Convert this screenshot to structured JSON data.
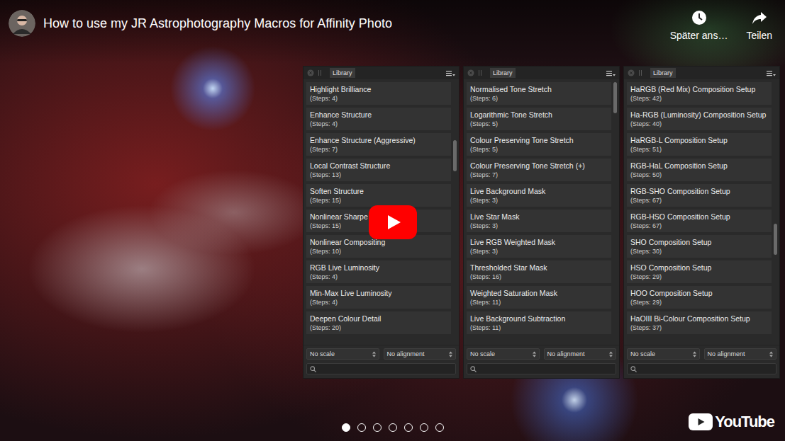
{
  "video": {
    "title": "How to use my JR Astrophotography Macros for Affinity Photo"
  },
  "actions": [
    {
      "label": "Später ans…",
      "kind": "clock"
    },
    {
      "label": "Teilen",
      "kind": "share"
    }
  ],
  "panels": [
    {
      "tab": "Library",
      "scroll": 0.28,
      "scale": "No scale",
      "alignment": "No alignment",
      "items": [
        {
          "name": "Highlight Brilliance",
          "steps": "(Steps: 4)"
        },
        {
          "name": "Enhance Structure",
          "steps": "(Steps: 4)"
        },
        {
          "name": "Enhance Structure (Aggressive)",
          "steps": "(Steps: 7)"
        },
        {
          "name": "Local Contrast Structure",
          "steps": "(Steps: 13)"
        },
        {
          "name": "Soften Structure",
          "steps": "(Steps: 15)"
        },
        {
          "name": "Nonlinear Sharpe",
          "steps": "(Steps: 15)"
        },
        {
          "name": "Nonlinear Compositing",
          "steps": "(Steps: 10)"
        },
        {
          "name": "RGB Live Luminosity",
          "steps": "(Steps: 4)"
        },
        {
          "name": "Min-Max Live Luminosity",
          "steps": "(Steps: 4)"
        },
        {
          "name": "Deepen Colour Detail",
          "steps": "(Steps: 20)"
        }
      ]
    },
    {
      "tab": "Library",
      "scroll": 0.0,
      "scale": "No scale",
      "alignment": "No alignment",
      "items": [
        {
          "name": "Normalised Tone Stretch",
          "steps": "(Steps: 6)"
        },
        {
          "name": "Logarithmic Tone Stretch",
          "steps": "(Steps: 5)"
        },
        {
          "name": "Colour Preserving Tone Stretch",
          "steps": "(Steps: 5)"
        },
        {
          "name": "Colour Preserving Tone Stretch (+)",
          "steps": "(Steps: 7)"
        },
        {
          "name": "Live Background Mask",
          "steps": "(Steps: 3)"
        },
        {
          "name": "Live Star Mask",
          "steps": "(Steps: 3)"
        },
        {
          "name": "Live RGB Weighted Mask",
          "steps": "(Steps: 3)"
        },
        {
          "name": "Thresholded Star Mask",
          "steps": "(Steps: 16)"
        },
        {
          "name": "Weighted Saturation Mask",
          "steps": "(Steps: 11)"
        },
        {
          "name": "Live Background Subtraction",
          "steps": "(Steps: 11)"
        }
      ]
    },
    {
      "tab": "Library",
      "scroll": 0.68,
      "scale": "No scale",
      "alignment": "No alignment",
      "items": [
        {
          "name": "HaRGB (Red Mix) Composition Setup",
          "steps": "(Steps: 42)"
        },
        {
          "name": "Ha-RGB (Luminosity) Composition Setup",
          "steps": "(Steps: 40)"
        },
        {
          "name": "HaRGB-L Composition Setup",
          "steps": "(Steps: 51)"
        },
        {
          "name": "RGB-HaL Composition Setup",
          "steps": "(Steps: 50)"
        },
        {
          "name": "RGB-SHO Composition Setup",
          "steps": "(Steps: 67)"
        },
        {
          "name": "RGB-HSO Composition Setup",
          "steps": "(Steps: 67)"
        },
        {
          "name": "SHO Composition Setup",
          "steps": "(Steps: 30)"
        },
        {
          "name": "HSO Composition Setup",
          "steps": "(Steps: 29)"
        },
        {
          "name": "HOO Composition Setup",
          "steps": "(Steps: 29)"
        },
        {
          "name": "HaOIII Bi-Colour Composition Setup",
          "steps": "(Steps: 37)"
        }
      ]
    }
  ],
  "slides": [
    {
      "selected": true
    },
    {
      "selected": false
    },
    {
      "selected": false
    },
    {
      "selected": false
    },
    {
      "selected": false
    },
    {
      "selected": false
    },
    {
      "selected": false
    }
  ],
  "logo": {
    "text": "YouTube"
  }
}
